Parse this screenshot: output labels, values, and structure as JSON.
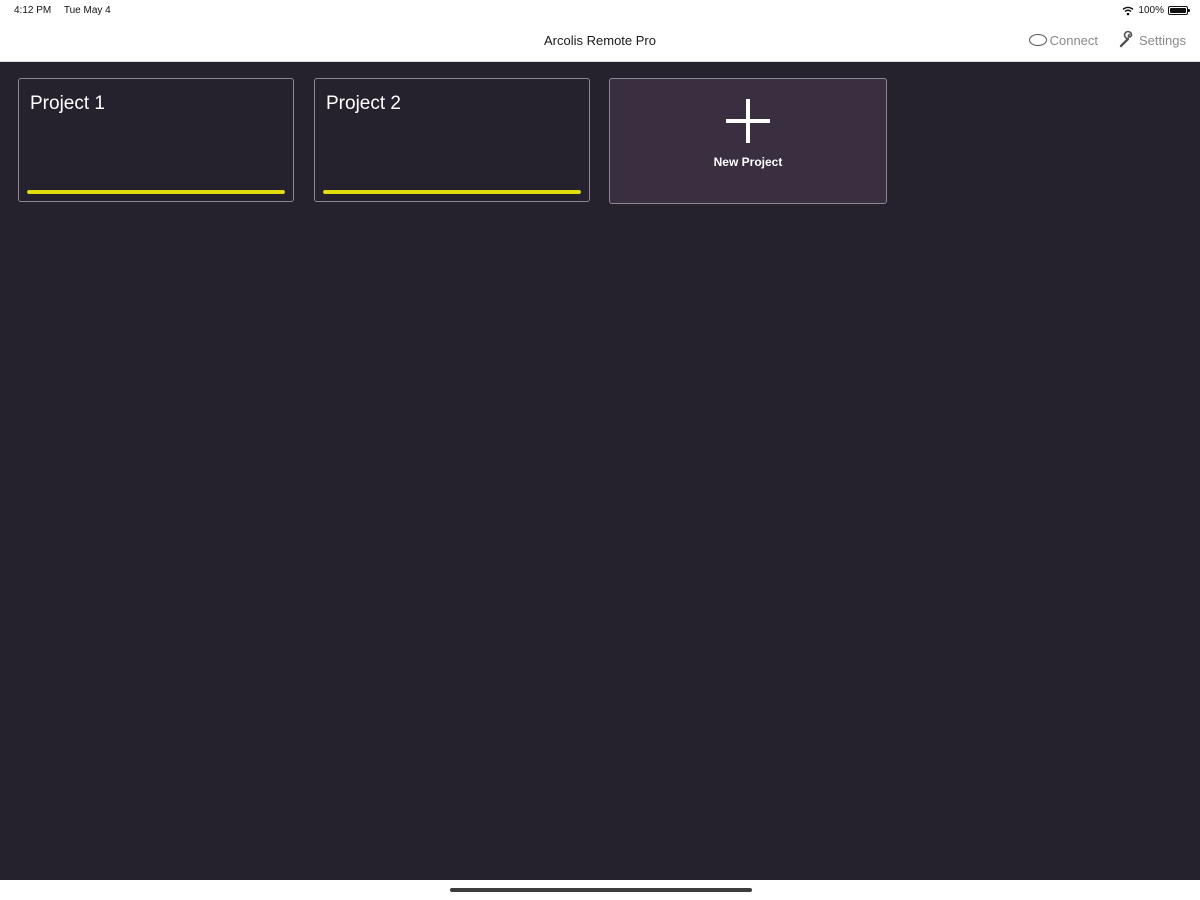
{
  "status": {
    "time": "4:12 PM",
    "date": "Tue May 4",
    "battery": "100%",
    "battery_level": 1.0
  },
  "nav": {
    "title": "Arcolis Remote Pro",
    "connect_label": "Connect",
    "settings_label": "Settings"
  },
  "projects": [
    {
      "name": "Project 1",
      "progress": 1.0,
      "bar_color": "#e0dc10"
    },
    {
      "name": "Project 2",
      "progress": 1.0,
      "bar_color": "#e0dc10"
    }
  ],
  "new_project": {
    "label": "New Project",
    "icon": "plus-icon"
  },
  "colors": {
    "background": "#26222d",
    "new_card": "#3a2f40",
    "accent": "#e0dc10"
  }
}
